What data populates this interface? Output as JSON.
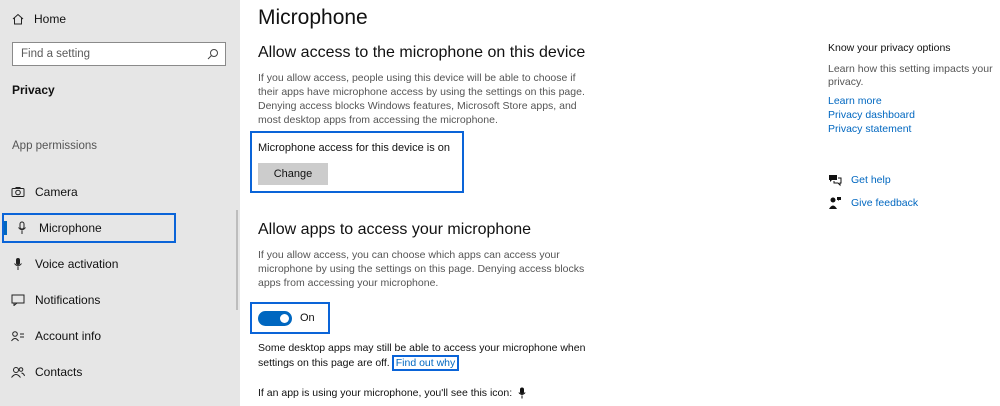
{
  "sidebar": {
    "home_label": "Home",
    "search_placeholder": "Find a setting",
    "section_title": "Privacy",
    "subsection_title": "App permissions",
    "items": [
      {
        "label": "Camera",
        "icon": "camera-icon"
      },
      {
        "label": "Microphone",
        "icon": "microphone-icon"
      },
      {
        "label": "Voice activation",
        "icon": "voice-activation-icon"
      },
      {
        "label": "Notifications",
        "icon": "notifications-icon"
      },
      {
        "label": "Account info",
        "icon": "account-info-icon"
      },
      {
        "label": "Contacts",
        "icon": "contacts-icon"
      }
    ],
    "active_item": "Microphone"
  },
  "main": {
    "title": "Microphone",
    "device_section": {
      "heading": "Allow access to the microphone on this device",
      "description": "If you allow access, people using this device will be able to choose if their apps have microphone access by using the settings on this page. Denying access blocks Windows features, Microsoft Store apps, and most desktop apps from accessing the microphone.",
      "status_label": "Microphone access for this device is on",
      "change_button": "Change"
    },
    "apps_section": {
      "heading": "Allow apps to access your microphone",
      "description": "If you allow access, you can choose which apps can access your microphone by using the settings on this page. Denying access blocks apps from accessing your microphone.",
      "toggle_state": "On",
      "toggle_on": true,
      "note": "Some desktop apps may still be able to access your microphone when settings on this page are off.",
      "note_link": "Find out why",
      "icon_note": "If an app is using your microphone, you'll see this icon:"
    }
  },
  "right": {
    "privacy_title": "Know your privacy options",
    "privacy_text": "Learn how this setting impacts your privacy.",
    "links": [
      "Learn more",
      "Privacy dashboard",
      "Privacy statement"
    ],
    "get_help": "Get help",
    "give_feedback": "Give feedback"
  },
  "colors": {
    "accent": "#0067c0",
    "highlight_border": "#0a64d8",
    "sidebar_bg": "#e6e6e6"
  }
}
